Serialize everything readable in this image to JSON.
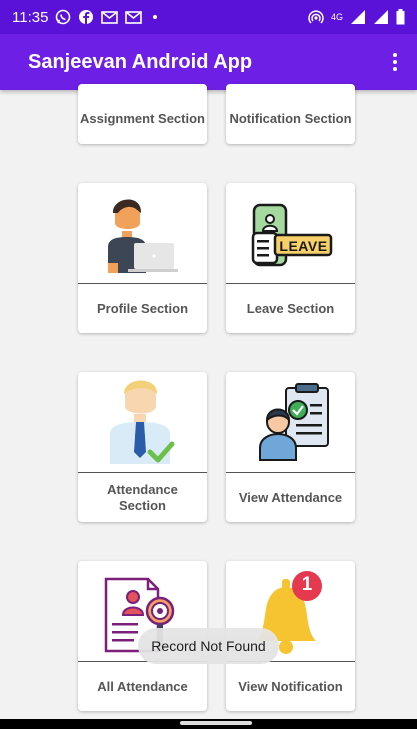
{
  "status_bar": {
    "time": "11:35",
    "network": "4G",
    "app_icons": [
      "whatsapp-icon",
      "facebook-icon",
      "gmail-icon",
      "gmail-icon"
    ],
    "system_icons": [
      "hotspot-icon",
      "signal-icon",
      "signal-icon",
      "battery-icon"
    ]
  },
  "app_bar": {
    "title": "Sanjeevan Android App"
  },
  "cards": {
    "assignment": "Assignment Section",
    "notification": "Notification Section",
    "profile": "Profile Section",
    "leave": "Leave Section",
    "leave_badge": "LEAVE",
    "attendance": "Attendance Section",
    "view_attendance": "View Attendance",
    "all_attendance": "All Attendance",
    "view_notification": "View Notification",
    "notification_count": "1"
  },
  "toast": "Record Not Found",
  "colors": {
    "status_bar": "#5b12d8",
    "app_bar": "#6d1fe6",
    "background": "#f2f2f2",
    "card": "#ffffff",
    "badge_red": "#e53950",
    "bell_yellow": "#f6c431"
  }
}
